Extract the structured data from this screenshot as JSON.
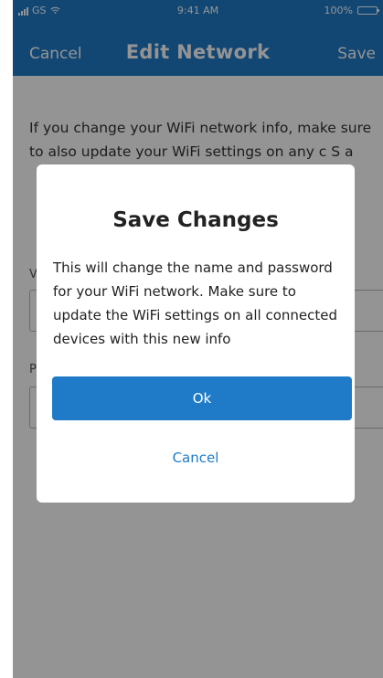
{
  "status_bar": {
    "carrier": "GS",
    "time": "9:41 AM",
    "battery": "100%",
    "icons": [
      "signal-icon",
      "wifi-icon",
      "battery-icon"
    ]
  },
  "nav": {
    "cancel_label": "Cancel",
    "title": "Edit Network",
    "save_label": "Save"
  },
  "content": {
    "intro": "If you change your WiFi network info, make sure to also update your WiFi settings on any c S a",
    "field1_label": "V",
    "field2_label": "P"
  },
  "modal": {
    "title": "Save Changes",
    "body": "This will change the name and password for your WiFi network. Make sure to update the WiFi settings on all connected devices with this new info",
    "ok_label": "Ok",
    "cancel_label": "Cancel"
  },
  "colors": {
    "brand": "#1f7bc8",
    "overlay": "rgba(0,0,0,0.42)",
    "text": "#222222"
  }
}
